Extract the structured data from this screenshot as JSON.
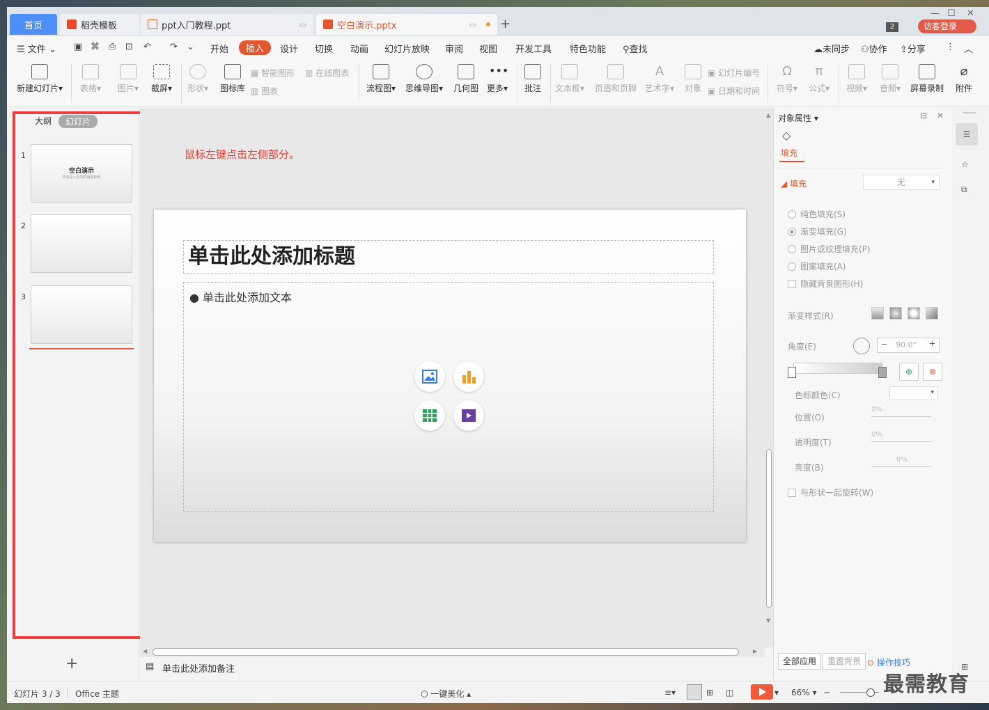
{
  "tabs": {
    "home": "首页",
    "daoke": "稻壳模板",
    "ppt_tutorial": "ppt入门教程.ppt",
    "active": "空白演示.pptx",
    "notif_count": "2",
    "guest_login": "访客登录"
  },
  "menu": {
    "file": "文件",
    "items": [
      "开始",
      "插入",
      "设计",
      "切换",
      "动画",
      "幻灯片放映",
      "审阅",
      "视图",
      "开发工具",
      "特色功能"
    ],
    "active": "插入",
    "search": "查找",
    "not_synced": "未同步",
    "collab": "协作",
    "share": "分享"
  },
  "ribbon": {
    "new_slide": "新建幻灯片",
    "table": "表格",
    "picture": "图片",
    "screenshot": "截屏",
    "shape": "形状",
    "icon_lib": "图标库",
    "smart_shape": "智能图形",
    "online_chart": "在线图表",
    "chart": "图表",
    "flowchart": "流程图",
    "mindmap": "思维导图",
    "geometry": "几何图",
    "more": "更多",
    "comment": "批注",
    "textbox": "文本框",
    "header_footer": "页眉和页脚",
    "wordart": "艺术字",
    "object": "对象",
    "slide_number": "幻灯片编号",
    "date_time": "日期和时间",
    "symbol": "符号",
    "formula": "公式",
    "video": "视频",
    "audio": "音频",
    "screen_record": "屏幕录制",
    "attachment": "附件"
  },
  "left_panel": {
    "outline_tab": "大纲",
    "slides_tab": "幻灯片",
    "thumbs": [
      {
        "num": "1",
        "title": "空白演示",
        "subtitle": "单击输入您的封面副标题"
      },
      {
        "num": "2"
      },
      {
        "num": "3"
      }
    ]
  },
  "editor": {
    "hint": "鼠标左键点击左侧部分。",
    "title_placeholder": "单击此处添加标题",
    "body_placeholder": "● 单击此处添加文本",
    "notes_placeholder": "单击此处添加备注"
  },
  "props": {
    "title": "对象属性",
    "fill_tab": "填充",
    "fill_section": "填充",
    "fill_value": "无",
    "options": [
      "纯色填充(S)",
      "渐变填充(G)",
      "图片或纹理填充(P)",
      "图案填充(A)"
    ],
    "hide_bg": "隐藏背景图形(H)",
    "gradient_style": "渐变样式(R)",
    "angle": "角度(E)",
    "angle_value": "90.0°",
    "stop_color": "色标颜色(C)",
    "position": "位置(O)",
    "position_value": "0%",
    "transparency": "透明度(T)",
    "transparency_value": "0%",
    "brightness": "亮度(B)",
    "brightness_value": "0%",
    "rotate_with_shape": "与形状一起旋转(W)",
    "apply_all": "全部应用",
    "reset_bg": "重置背景",
    "tips": "操作技巧"
  },
  "status": {
    "slide_count": "幻灯片 3 / 3",
    "theme": "Office 主题",
    "beautify": "一键美化",
    "zoom": "66%"
  },
  "watermark": "最需教育",
  "colors": {
    "accent": "#e4572e",
    "highlight_box": "#f03c3c",
    "home_tab": "#4e8ef7"
  }
}
